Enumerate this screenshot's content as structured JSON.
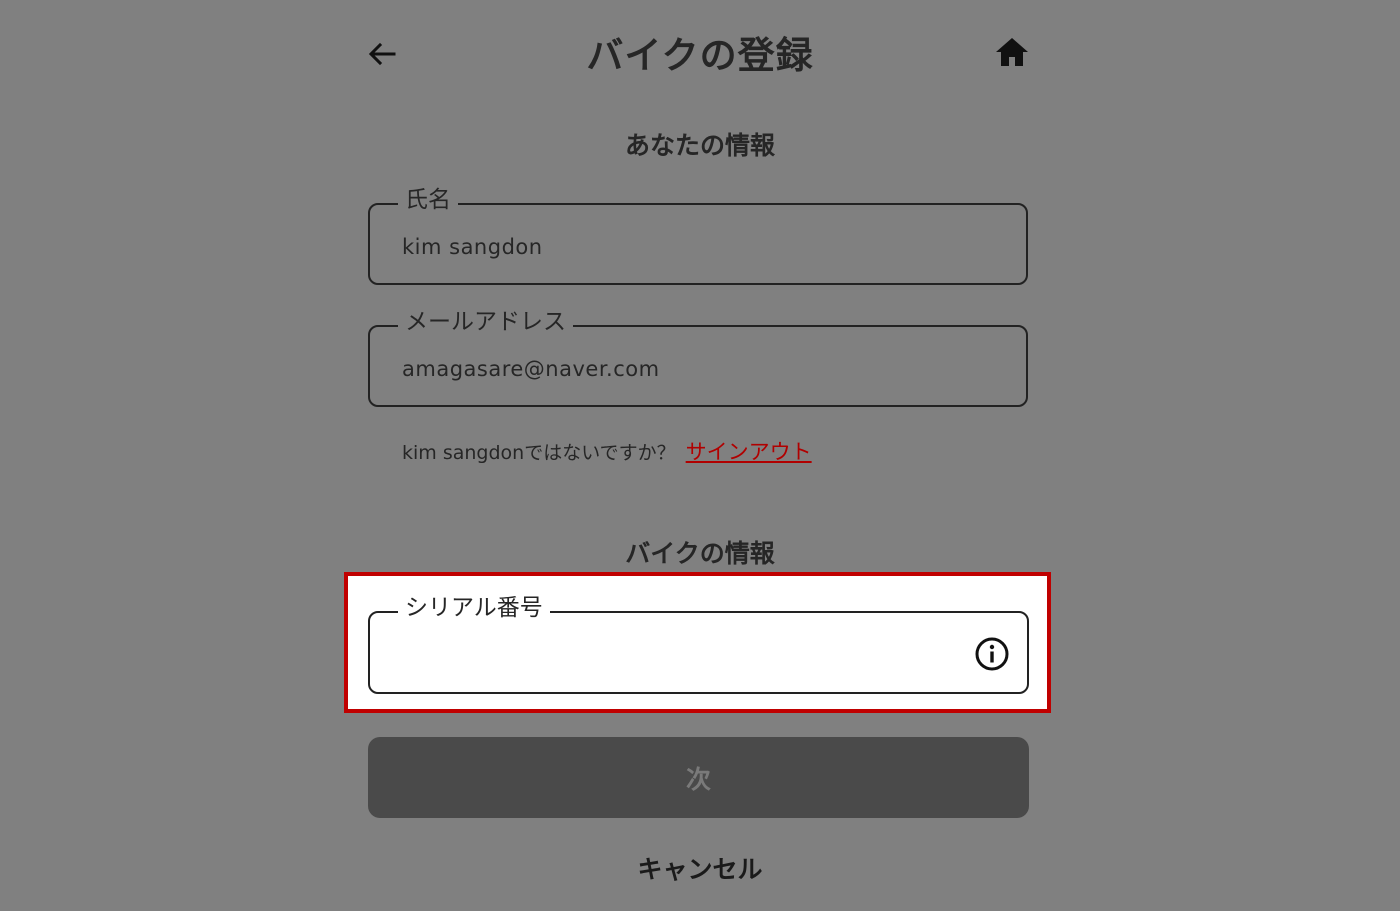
{
  "header": {
    "title": "バイクの登録",
    "back_icon": "arrow-left-icon",
    "home_icon": "home-icon"
  },
  "your_info": {
    "heading": "あなたの情報",
    "name_label": "氏名",
    "name_value": "kim sangdon",
    "email_label": "メールアドレス",
    "email_value": "amagasare@naver.com",
    "not_you_text": "kim sangdonではないですか？",
    "signout_link": "サインアウト"
  },
  "bike_info": {
    "heading": "バイクの情報",
    "serial_label": "シリアル番号",
    "serial_value": "",
    "info_icon": "info-icon"
  },
  "actions": {
    "next_label": "次",
    "cancel_label": "キャンセル"
  },
  "colors": {
    "overlay_background": "#808080",
    "highlight_border": "#c00000",
    "link": "#b10000",
    "disabled_button": "#4a4a4a"
  }
}
